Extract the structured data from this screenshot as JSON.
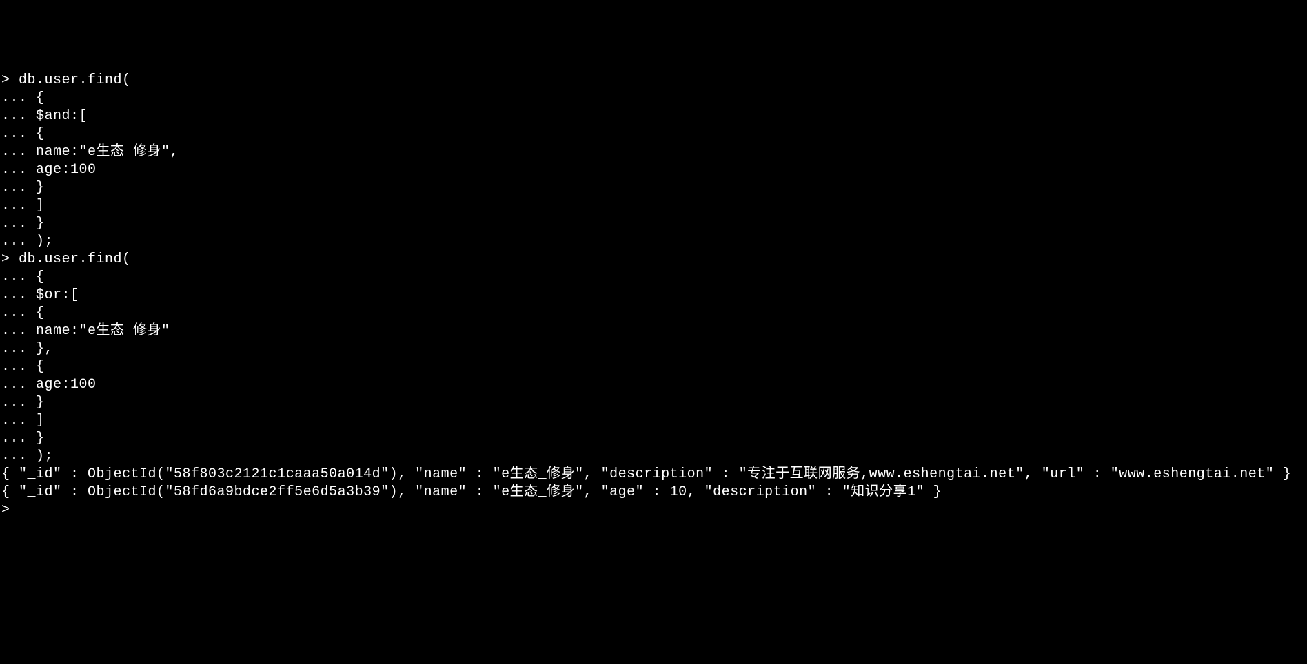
{
  "terminal": {
    "lines": [
      "> db.user.find(",
      "... {",
      "... $and:[",
      "... {",
      "... name:\"e生态_修身\",",
      "... age:100",
      "... }",
      "... ]",
      "... }",
      "... );",
      "> db.user.find(",
      "... {",
      "... $or:[",
      "... {",
      "... name:\"e生态_修身\"",
      "... },",
      "... {",
      "... age:100",
      "... }",
      "... ]",
      "... }",
      "... );",
      "{ \"_id\" : ObjectId(\"58f803c2121c1caaa50a014d\"), \"name\" : \"e生态_修身\", \"description\" : \"专注于互联网服务,www.eshengtai.net\", \"url\" : \"www.eshengtai.net\" }",
      "{ \"_id\" : ObjectId(\"58fd6a9bdce2ff5e6d5a3b39\"), \"name\" : \"e生态_修身\", \"age\" : 10, \"description\" : \"知识分享1\" }",
      ">"
    ]
  }
}
